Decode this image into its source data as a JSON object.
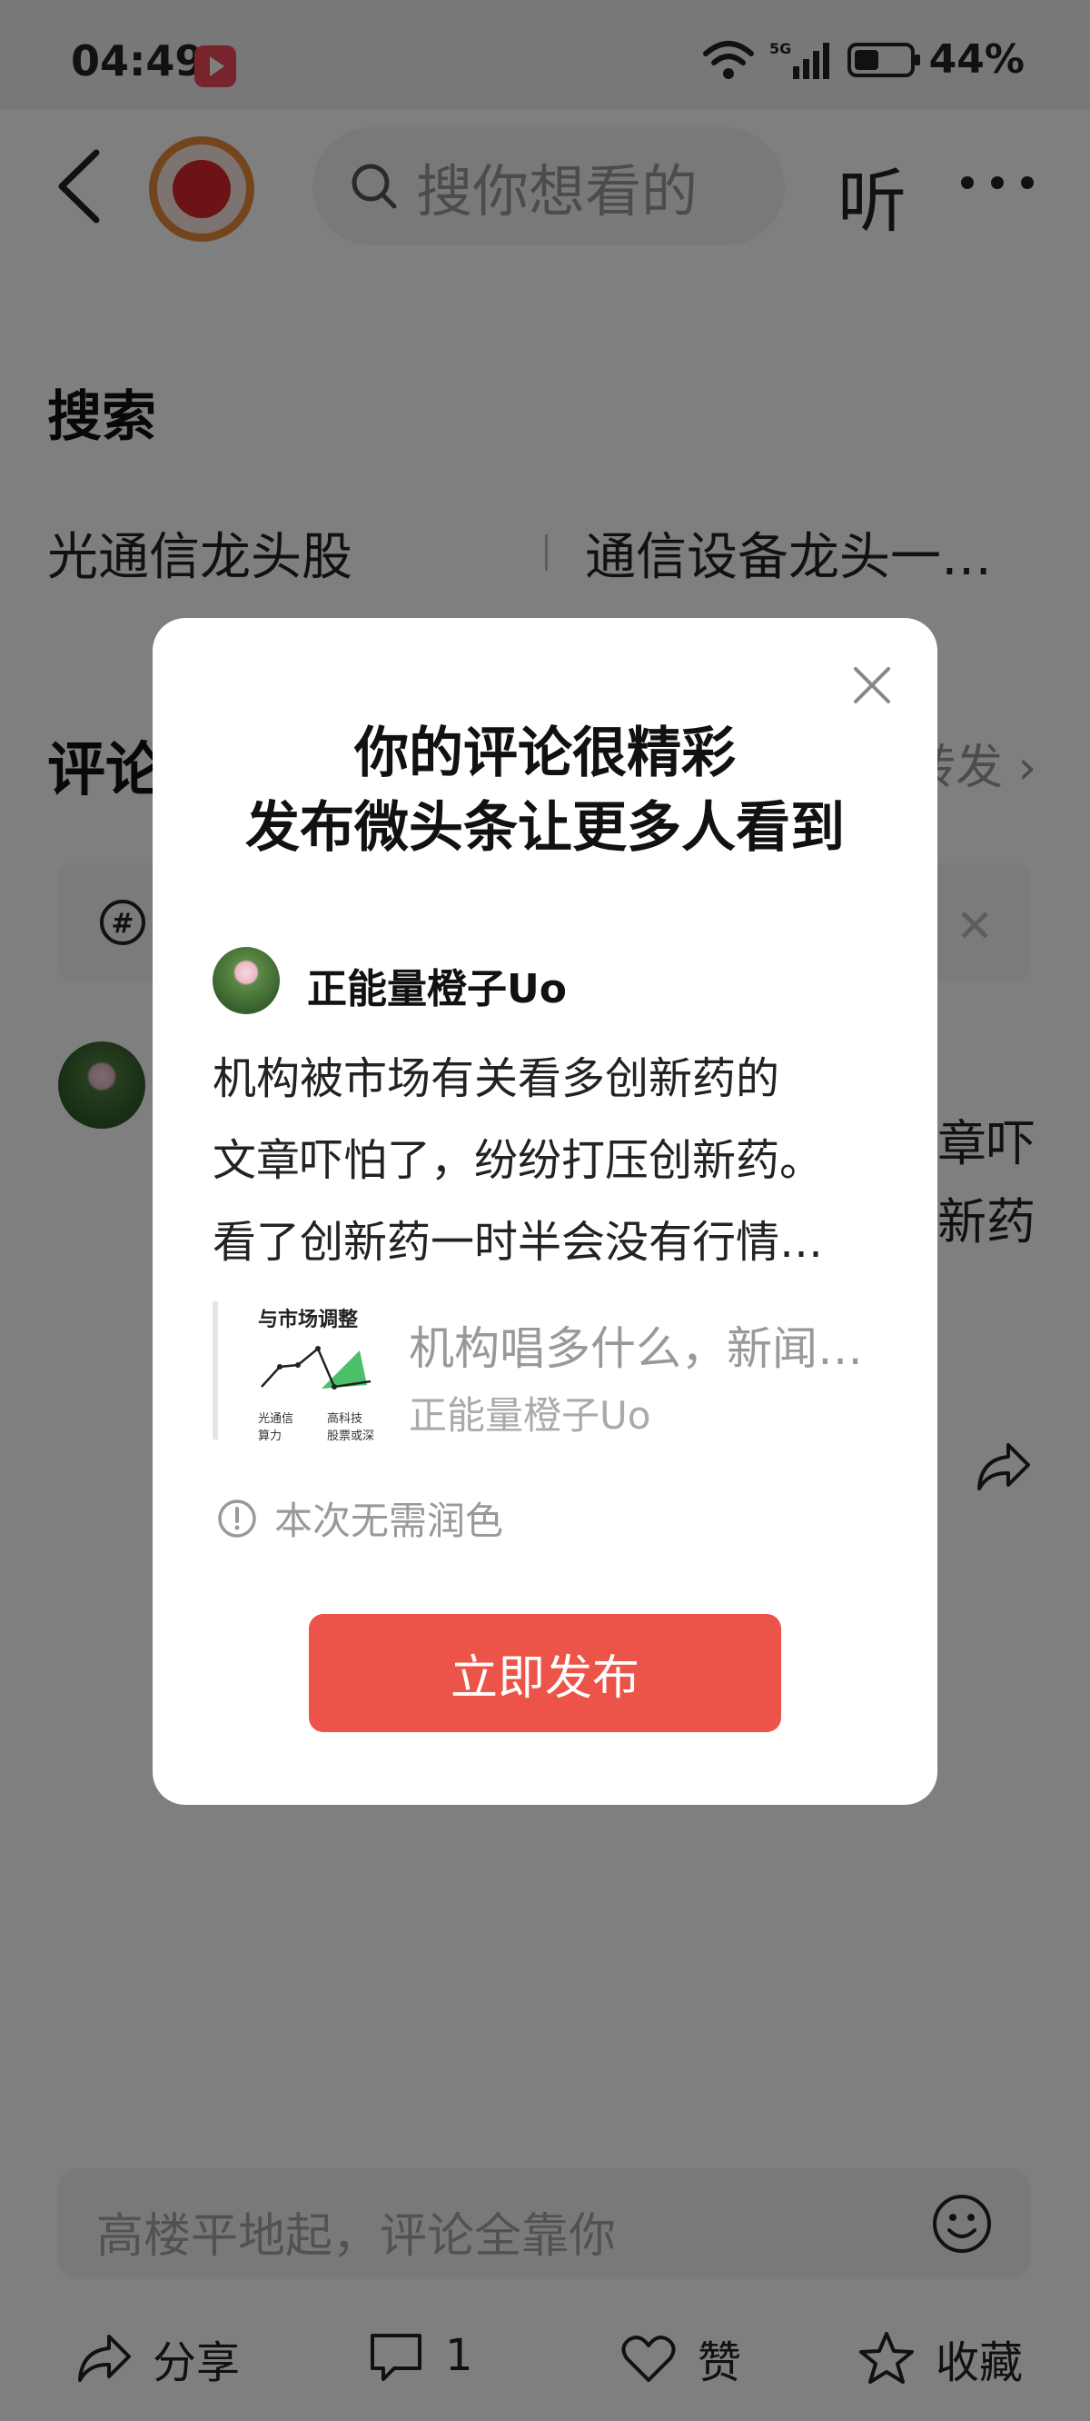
{
  "status_bar": {
    "time": "04:49",
    "battery": "44%",
    "battery_level": 0.44,
    "network": "5G"
  },
  "header": {
    "search_placeholder": "搜你想看的",
    "listen": "听"
  },
  "search_section": {
    "title": "搜索",
    "suggestions": [
      "光通信龙头股",
      "通信设备龙头一…"
    ]
  },
  "comment_section": {
    "title": "评论",
    "repost": "转发",
    "comment_text": "章吓\n新药"
  },
  "bottom_bar": {
    "input_placeholder": "高楼平地起，评论全靠你",
    "share": "分享",
    "comment_count": "1",
    "like": "赞",
    "favorite": "收藏"
  },
  "dialog": {
    "title_line1": "你的评论很精彩",
    "title_line2": "发布微头条让更多人看到",
    "user_name": "正能量橙子Uo",
    "comment_lines": [
      "机构被市场有关看多创新药的",
      "文章吓怕了，纷纷打压创新药。",
      "看了创新药一时半会没有行情…"
    ],
    "ref": {
      "thumb_heading": "与市场调整",
      "thumb_label_left": "光通信\n算力",
      "thumb_label_right": "高科技\n股票或深",
      "title": "机构唱多什么，新闻…",
      "author": "正能量橙子Uo"
    },
    "hint": "本次无需润色",
    "publish_button": "立即发布",
    "accent_color": "#ec5449"
  }
}
